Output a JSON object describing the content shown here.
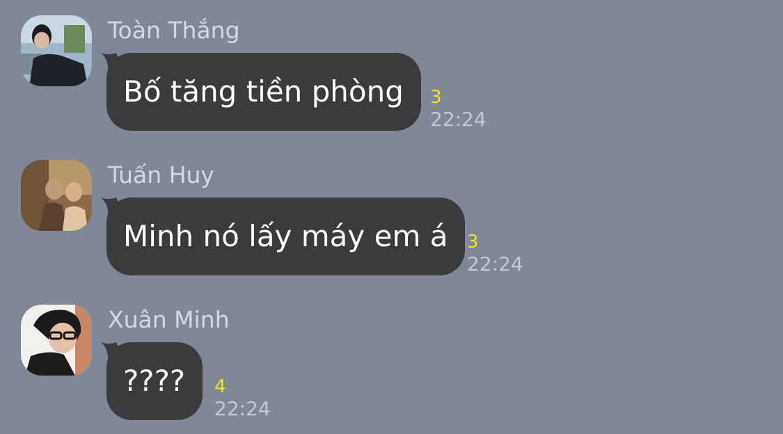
{
  "messages": [
    {
      "sender": "Toàn Thắng",
      "text": "Bố tăng tiền phòng",
      "unread": "3",
      "time": "22:24",
      "avatar": "person-in-black-shirt-city-background"
    },
    {
      "sender": "Tuấn Huy",
      "text": "Minh nó lấy máy em á",
      "unread": "3",
      "time": "22:24",
      "avatar": "two-people-selfie-warm-tones"
    },
    {
      "sender": "Xuân Minh",
      "text": "????",
      "unread": "4",
      "time": "22:24",
      "avatar": "person-with-glasses-white-background"
    }
  ],
  "colors": {
    "background": "#808898",
    "bubble": "#3b3b3e",
    "unread": "#f5e21a",
    "time": "#c4c8d2",
    "sender": "#d4d8e0"
  }
}
